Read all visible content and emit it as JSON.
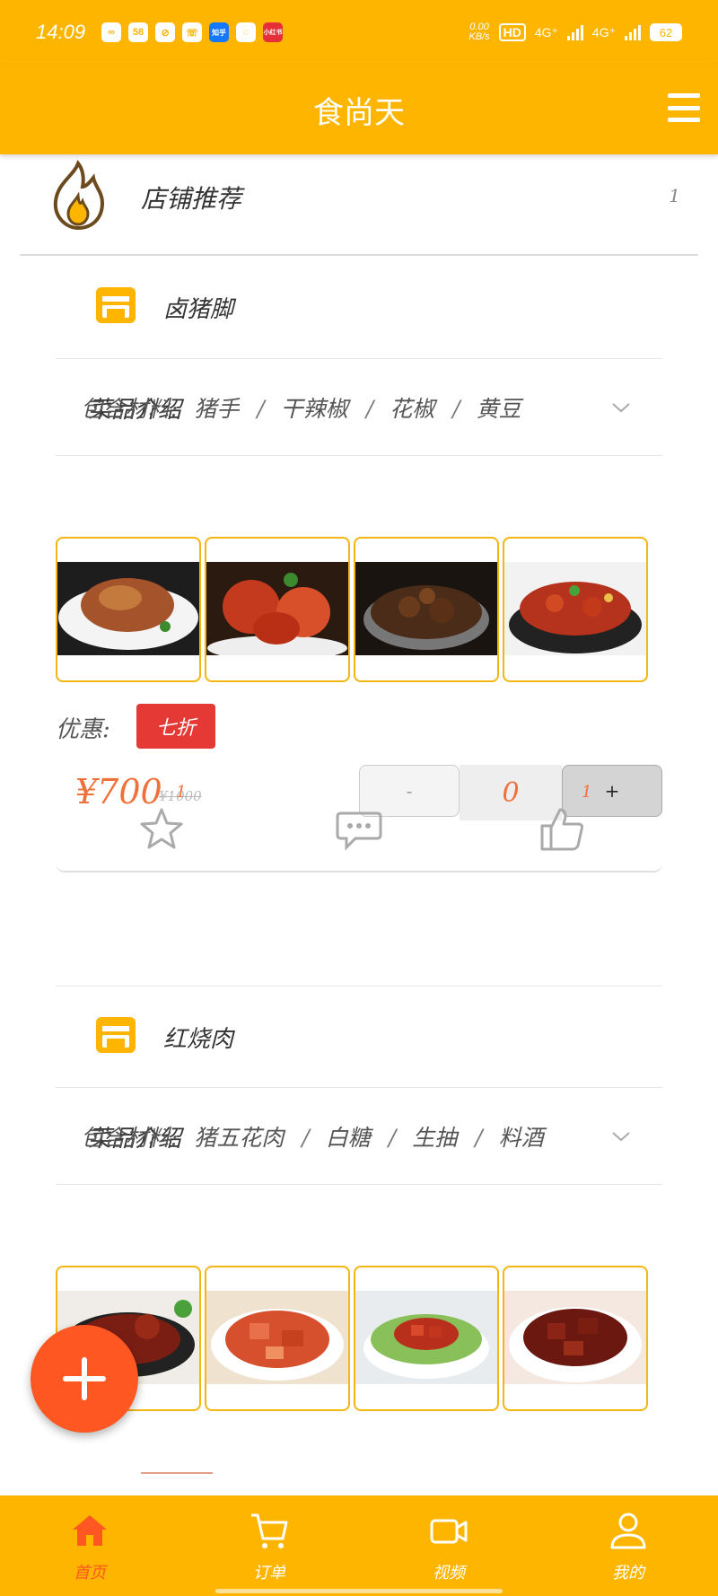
{
  "status_bar": {
    "time": "14:09",
    "apps": [
      "58",
      "知乎",
      "小红书"
    ],
    "net_speed_value": "0.00",
    "net_speed_unit": "KB/s",
    "hd": "HD",
    "net1": "4G⁺",
    "net2": "4G⁺",
    "battery": "62"
  },
  "header": {
    "title": "食尚天"
  },
  "recommend": {
    "title": "店铺推荐",
    "count": "1"
  },
  "dishes": [
    {
      "name": "卤猪脚",
      "intro_label": "菜品介绍",
      "ingredients_label": "包含材料:",
      "ingredients": [
        "猪手",
        "干辣椒",
        "花椒",
        "黄豆"
      ],
      "discount_label": "优惠:",
      "discount": "七折",
      "price": "¥700",
      "old_price": "¥1000",
      "minus": "-",
      "quantity": "0",
      "plus": "+",
      "favorite_count": "1",
      "like_count": "1"
    },
    {
      "name": "红烧肉",
      "intro_label": "菜品介绍",
      "ingredients_label": "包含材料:",
      "ingredients": [
        "猪五花肉",
        "白糖",
        "生抽",
        "料酒"
      ]
    }
  ],
  "tabs": [
    {
      "label": "首页",
      "icon": "home-icon",
      "active": true
    },
    {
      "label": "订单",
      "icon": "cart-icon",
      "active": false
    },
    {
      "label": "视频",
      "icon": "video-icon",
      "active": false
    },
    {
      "label": "我的",
      "icon": "user-icon",
      "active": false
    }
  ],
  "colors": {
    "brand": "#FDB500",
    "accent": "#FF5722",
    "price": "#F0703A",
    "badge": "#E53935",
    "thumb_border": "#F5B512"
  }
}
